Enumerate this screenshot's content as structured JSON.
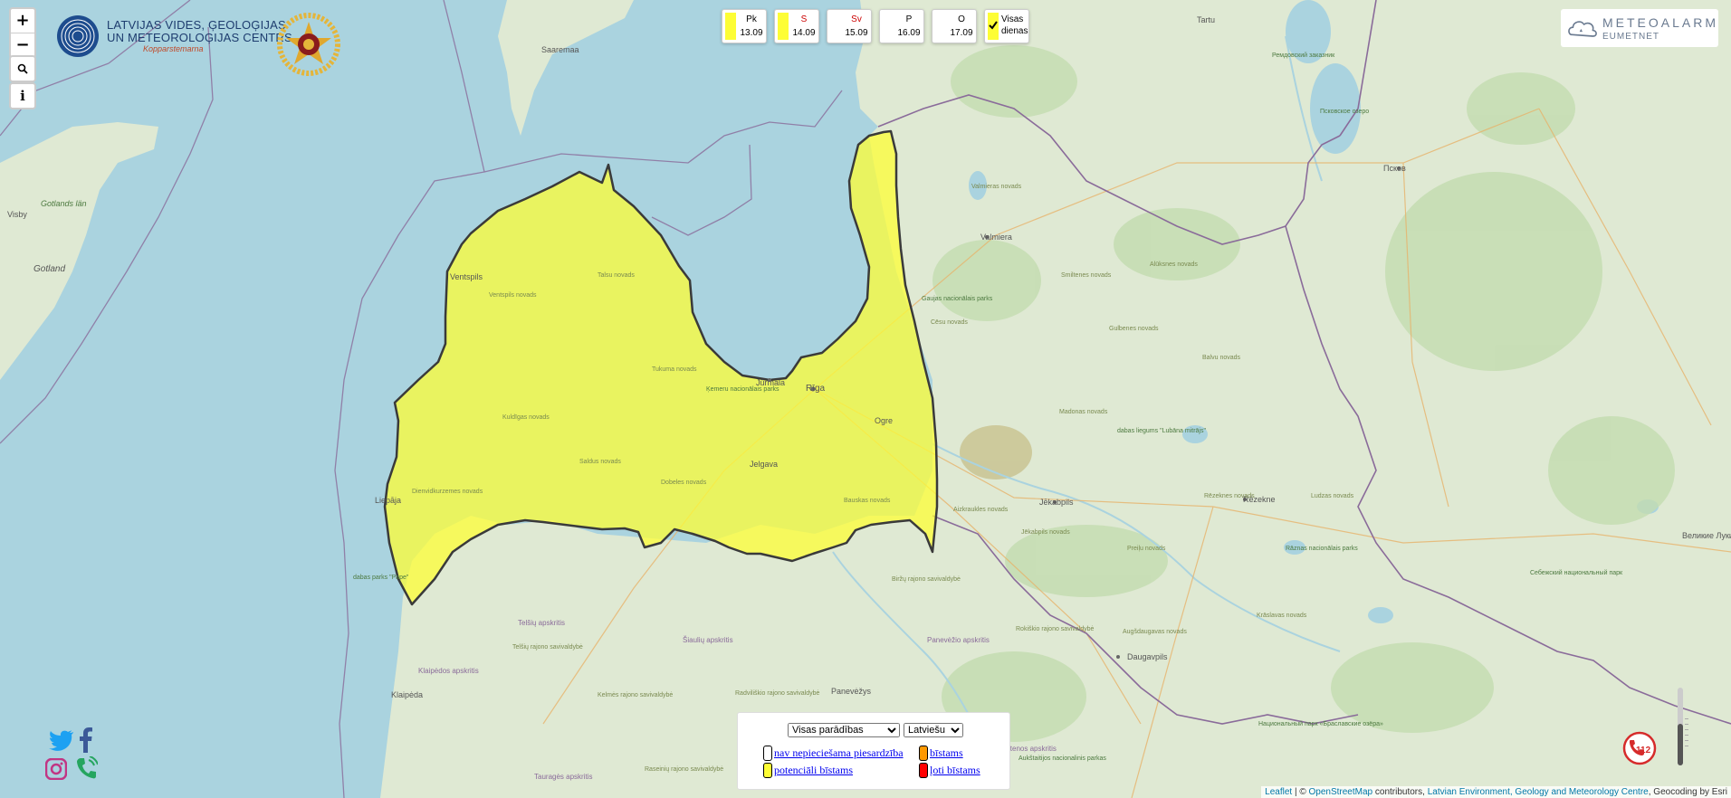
{
  "map_controls": {
    "zoom_in": "+",
    "zoom_out": "−",
    "search": "🔍",
    "info": "i"
  },
  "logo_lvgmc": {
    "line1": "LATVIJAS VIDES, ĢEOLOĢIJAS",
    "line2": "UN METEOROLOĢIJAS CENTRS",
    "sub": "Kopparstemarna"
  },
  "days": [
    {
      "name": "Pk",
      "date": "13.09",
      "color": "#fdfd35",
      "name_color": "#000000"
    },
    {
      "name": "S",
      "date": "14.09",
      "color": "#fdfd35",
      "name_color": "#cc0000"
    },
    {
      "name": "Sv",
      "date": "15.09",
      "color": "#ffffff",
      "name_color": "#cc0000"
    },
    {
      "name": "P",
      "date": "16.09",
      "color": "#ffffff",
      "name_color": "#000000"
    },
    {
      "name": "O",
      "date": "17.09",
      "color": "#ffffff",
      "name_color": "#000000"
    }
  ],
  "all_days": {
    "line1": "Visas",
    "line2": "dienas"
  },
  "meteoalarm": {
    "title": "METEOALARM",
    "sub": "EUMETNET"
  },
  "legend": {
    "phenomena_select": "Visas parādības",
    "language_select": "Latviešu",
    "items": [
      {
        "label": "nav nepieciešama piesardzība",
        "color": "#ffffff"
      },
      {
        "label": "bīstams",
        "color": "#ff9900"
      },
      {
        "label": "potenciāli bīstams",
        "color": "#fdfd35"
      },
      {
        "label": "ļoti bīstams",
        "color": "#ff0000"
      }
    ]
  },
  "map_labels": {
    "saaremaa": "Saaremaa",
    "gotland": "Gotland",
    "gotlands_lan": "Gotlands län",
    "visby": "Visby",
    "ventspils": "Ventspils",
    "liepaja": "Liepāja",
    "riga": "Rīga",
    "jurmala": "Jūrmala",
    "ogre": "Ogre",
    "jelgava": "Jelgava",
    "tukums": "Tukuma novads",
    "kemeri": "Ķemeru nacionālais parks",
    "talsi": "Talsu novads",
    "kuldiga": "Kuldīgas novads",
    "saldus": "Saldus novads",
    "dienvidkurzeme": "Dienvidkurzemes novads",
    "dobele": "Dobeles novads",
    "bauska": "Bauskas novads",
    "ventspils_nov": "Ventspils novads",
    "dabas_parks_pape": "dabas parks \"Pape\"",
    "valmiera": "Valmiera",
    "valmieras_novads": "Valmieras novads",
    "gaujas_parks": "Gaujas nacionālais parks",
    "cesu_novads": "Cēsu novads",
    "smiltenes": "Smiltenes novads",
    "alukanes": "Alūksnes novads",
    "gulbenes": "Gulbenes novads",
    "balvu": "Balvu novads",
    "madonas": "Madonas novads",
    "lubana": "dabas liegums \"Lubāna mitrājs\"",
    "aizkraukles": "Aizkraukles novads",
    "jekabpils": "Jēkabpils",
    "jekabpils_nov": "Jēkabpils novads",
    "rezekne": "Rēzekne",
    "rezeknes_nov": "Rēzeknes novads",
    "ludzas": "Ludzas novads",
    "preilu": "Preiļu novads",
    "razna": "Rāznas nacionālais parks",
    "kraslavas": "Krāslavas novads",
    "augsdaugavas": "Augšdaugavas novads",
    "daugavpils": "Daugavpils",
    "tartu": "Tartu",
    "pskov": "Псков",
    "velikie_luki": "Великие Луки",
    "sebezh": "Себежский национальный парк",
    "remdov": "Ремдовский заказник",
    "pskovskoe": "Псковское озеро",
    "siauliai": "Šiaulių apskritis",
    "panevezys": "Panevėžys",
    "panevezio": "Panevėžio apskritis",
    "klaipeda": "Klaipėda",
    "klaipedos": "Klaipėdos apskritis",
    "telsiu": "Telšių apskritis",
    "rokiskio": "Rokiškio rajono savivaldybė",
    "birzu": "Biržų rajono savivaldybė",
    "utenos": "Utenos apskritis",
    "taurages": "Tauragės apskritis",
    "radviliskio": "Radviliškio rajono savivaldybė",
    "kelmes": "Kelmės rajono savivaldybė",
    "raseiniu": "Raseinių rajono savivaldybė",
    "telsiu_raj": "Telšių rajono savivaldybė",
    "aukstaitijos": "Aukštaitijos nacionalinis parkas",
    "braslav": "Национальный парк «Браславские озёра»"
  },
  "attribution": {
    "leaflet": "Leaflet",
    "osm_prefix": " | © ",
    "osm": "OpenStreetMap",
    "contributors": " contributors, ",
    "lvgmc": "Latvian Environment, Geology and Meteorology Centre",
    "geocoding": ", Geocoding by Esri"
  },
  "sos_label": "112",
  "colors": {
    "sea": "#aad3df",
    "land": "#dbe8d0",
    "warning_yellow": "#fdfd35",
    "border": "#8a6b9a"
  }
}
